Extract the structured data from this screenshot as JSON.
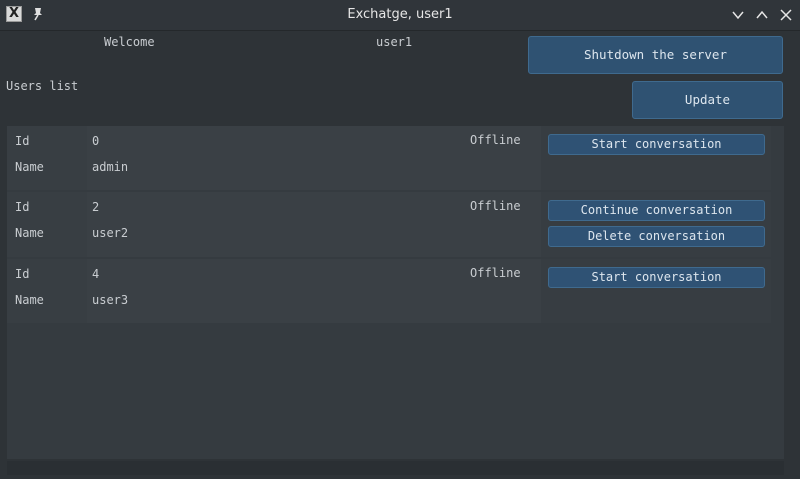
{
  "window": {
    "title": "Exchatge, user1"
  },
  "header": {
    "welcome_label": "Welcome",
    "username": "user1",
    "shutdown_label": "Shutdown the server",
    "users_list_label": "Users list",
    "update_label": "Update"
  },
  "users": [
    {
      "id_label": "Id",
      "id": "0",
      "name_label": "Name",
      "name": "admin",
      "status": "Offline",
      "actions": [
        "Start conversation"
      ]
    },
    {
      "id_label": "Id",
      "id": "2",
      "name_label": "Name",
      "name": "user2",
      "status": "Offline",
      "actions": [
        "Continue conversation",
        "Delete conversation"
      ]
    },
    {
      "id_label": "Id",
      "id": "4",
      "name_label": "Name",
      "name": "user3",
      "status": "Offline",
      "actions": [
        "Start conversation"
      ]
    }
  ],
  "icons": {
    "app": "x11-app-icon",
    "pin": "pin-icon",
    "minimize": "chevron-down-icon",
    "maximize": "chevron-up-icon",
    "close": "close-icon"
  },
  "colors": {
    "background": "#2e3337",
    "button": "#2f5272",
    "text": "#c9cdd1"
  }
}
